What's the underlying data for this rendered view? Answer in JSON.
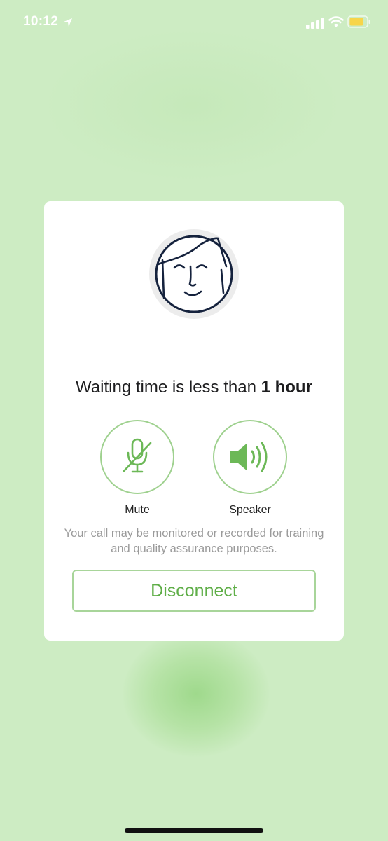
{
  "status_bar": {
    "time": "10:12",
    "icons": [
      "location-arrow-icon",
      "cellular-signal-icon",
      "wifi-icon",
      "battery-icon"
    ],
    "battery_color": "#f7d54a"
  },
  "call_card": {
    "avatar_icon": "agent-face-icon",
    "waiting_prefix": "Waiting time is less than ",
    "waiting_value": "1 hour",
    "mute": {
      "icon": "mic-muted-icon",
      "label": "Mute"
    },
    "speaker": {
      "icon": "speaker-volume-icon",
      "label": "Speaker"
    },
    "disclaimer": "Your call may be monitored or recorded for training and quality assurance purposes.",
    "disconnect_label": "Disconnect"
  },
  "colors": {
    "background": "#cdecc3",
    "accent_green": "#5fae48",
    "button_border": "#a8d59a",
    "avatar_stroke": "#15223d"
  }
}
